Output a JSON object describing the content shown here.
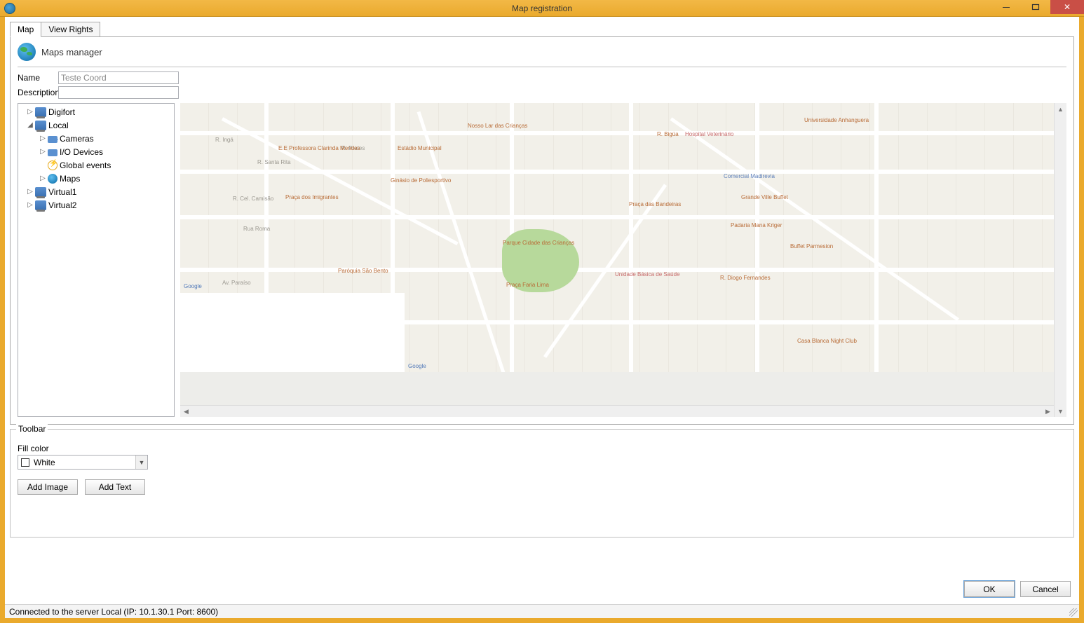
{
  "window": {
    "title": "Map registration"
  },
  "tabs": [
    {
      "label": "Map",
      "active": true
    },
    {
      "label": "View Rights",
      "active": false
    }
  ],
  "section": {
    "title": "Maps manager"
  },
  "form": {
    "name_label": "Name",
    "name_value": "Teste Coord",
    "description_label": "Description",
    "description_value": ""
  },
  "tree": {
    "items": [
      {
        "label": "Digifort"
      },
      {
        "label": "Local"
      },
      {
        "label": "Cameras"
      },
      {
        "label": "I/O Devices"
      },
      {
        "label": "Global events"
      },
      {
        "label": "Maps"
      },
      {
        "label": "Virtual1"
      },
      {
        "label": "Virtual2"
      }
    ]
  },
  "toolbar": {
    "legend": "Toolbar",
    "fill_label": "Fill color",
    "fill_value": "White",
    "add_image": "Add Image",
    "add_text": "Add Text"
  },
  "buttons": {
    "ok": "OK",
    "cancel": "Cancel"
  },
  "status": {
    "text": "Connected to the server Local (IP: 10.1.30.1 Port: 8600)"
  }
}
